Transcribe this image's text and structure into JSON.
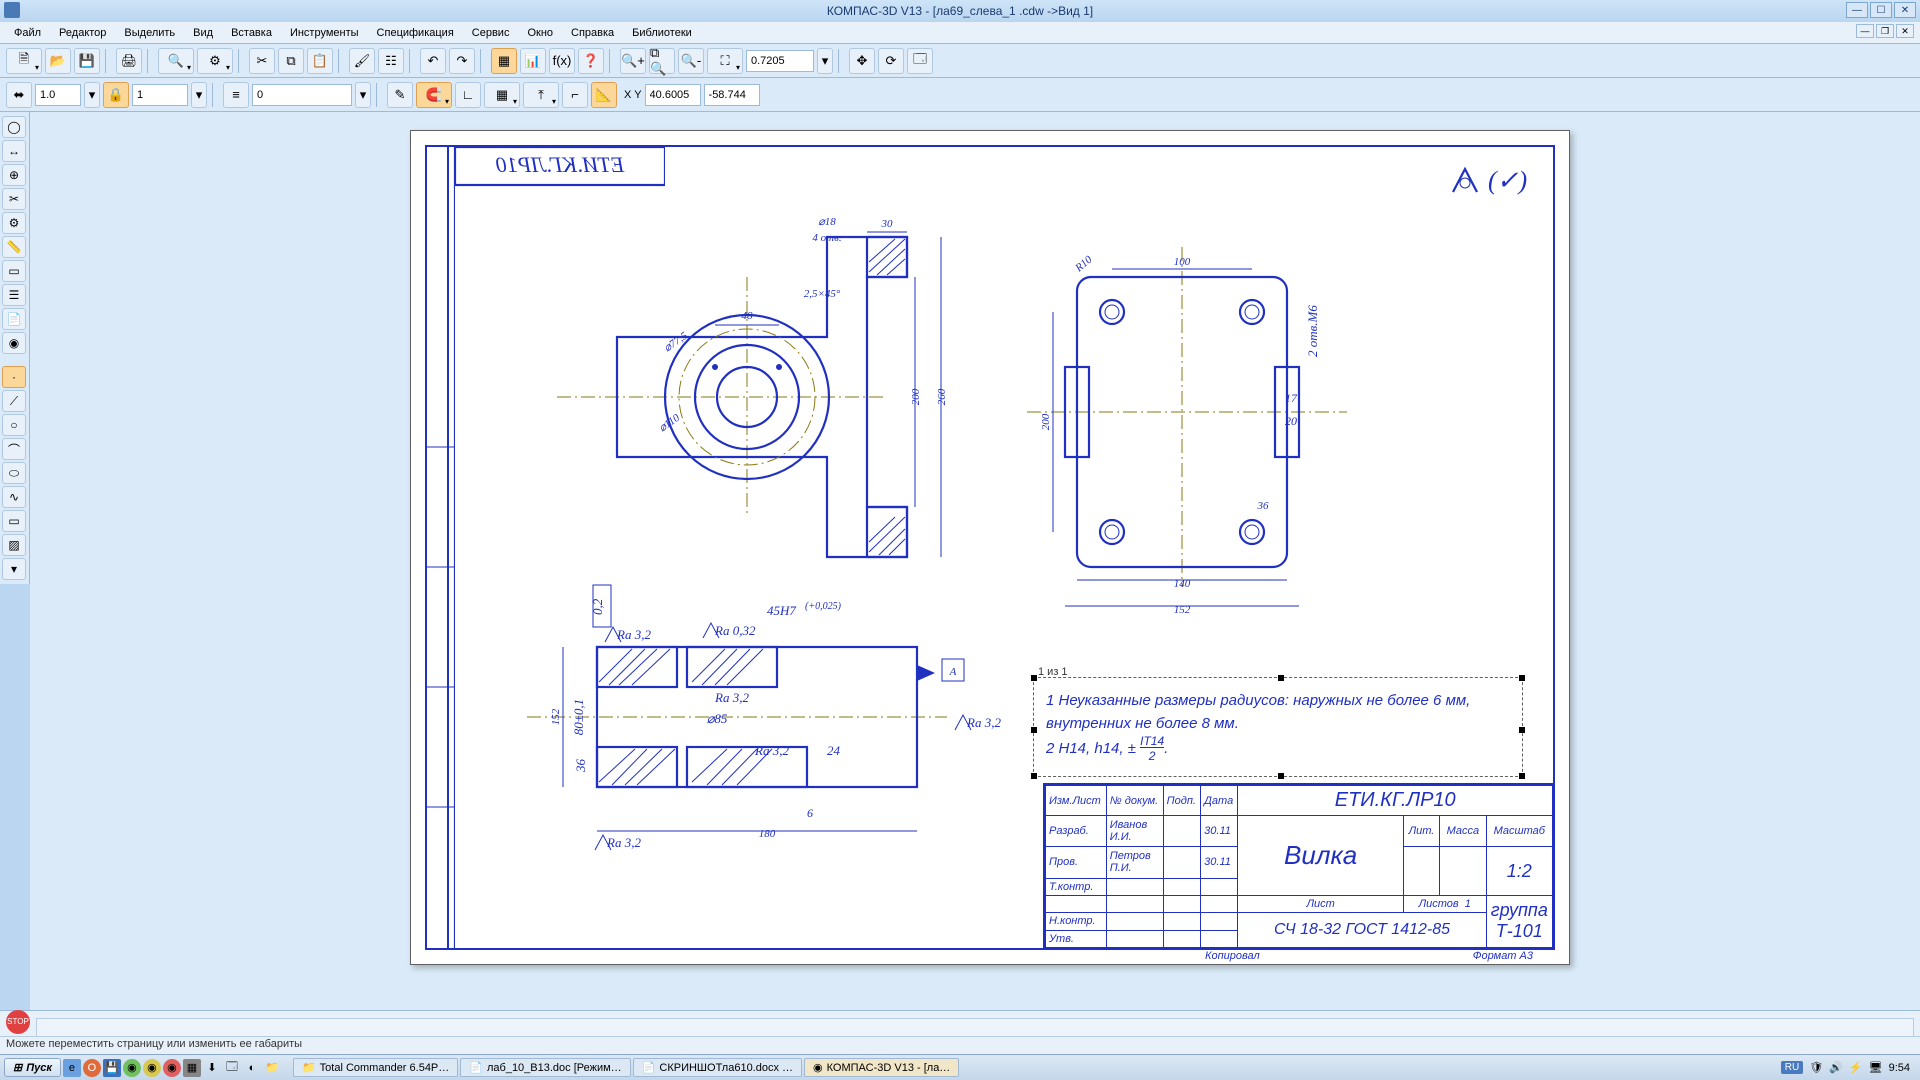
{
  "title": "КОМПАС-3D V13 - [ла69_слева_1 .cdw ->Вид 1]",
  "menu": [
    "Файл",
    "Редактор",
    "Выделить",
    "Вид",
    "Вставка",
    "Инструменты",
    "Спецификация",
    "Сервис",
    "Окно",
    "Справка",
    "Библиотеки"
  ],
  "toolbar2": {
    "lineweight": "1.0",
    "layer": "1",
    "style": "0",
    "zoom": "0.7205",
    "coordX": "40.6005",
    "coordY": "-58.744"
  },
  "status_hint": "Можете переместить страницу или изменить ее габариты",
  "taskbar": {
    "start": "Пуск",
    "items": [
      "Total Commander 6.54P…",
      "лаб_10_В13.doc  [Режим…",
      "СКРИНШОТла610.docx …",
      "КОМПАС-3D V13 - [ла…"
    ],
    "lang": "RU",
    "clock": "9:54"
  },
  "drawing": {
    "stamp_title": "ЕТИ.КГ.ЛР10",
    "notes_page": "1 из 1",
    "note1": "1 Неуказанные размеры радиусов: наружных не более 6 мм, внутренних не более 8 мм.",
    "note2_a": "2 H14, h14, ±",
    "note2_b": "IT14",
    "note2_c": "2",
    "titleblock": {
      "code": "ЕТИ.КГ.ЛР10",
      "name": "Вилка",
      "material": "СЧ 18-32 ГОСТ 1412-85",
      "group": "группа Т-101",
      "scale": "1:2",
      "sheets": "1",
      "mass_h": "Масса",
      "scale_h": "Масштаб",
      "lit_h": "Лит.",
      "sheet_h": "Лист",
      "sheets_h": "Листов",
      "copied": "Копировал",
      "format": "Формат    А3",
      "rows": {
        "r1": "Изм.Лист",
        "r1b": "№ докум.",
        "r1c": "Подп.",
        "r1d": "Дата",
        "r2": "Разраб.",
        "r2b": "Иванов И.И.",
        "r2d": "30.11",
        "r3": "Пров.",
        "r3b": "Петров П.И.",
        "r3d": "30.11",
        "r4": "Т.контр.",
        "r5": "Н.контр.",
        "r6": "Утв."
      }
    },
    "dims": {
      "d48": "48",
      "d30": "30",
      "d18": "⌀18",
      "d4otv": "4 отв.",
      "c25x45": "2,5×45°",
      "d775": "⌀77,5",
      "d110": "⌀110",
      "d200": "200",
      "d260": "260",
      "r10": "R10",
      "d100": "100",
      "d200b": "200",
      "d140": "140",
      "d152": "152",
      "d36": "36",
      "d17": "17",
      "d20": "20",
      "d2otvM6": "2 отв.М6",
      "ra32": "Ra 3,2",
      "ra032": "Ra 0,32",
      "q02": "0,2",
      "secA": "А",
      "d45h7": "45H7",
      "tol": "(+0,025)",
      "d152b": "152",
      "d80": "80±0,1",
      "d85": "⌀85",
      "d24": "24",
      "d180": "180",
      "d36b": "36",
      "d6": "6"
    }
  }
}
